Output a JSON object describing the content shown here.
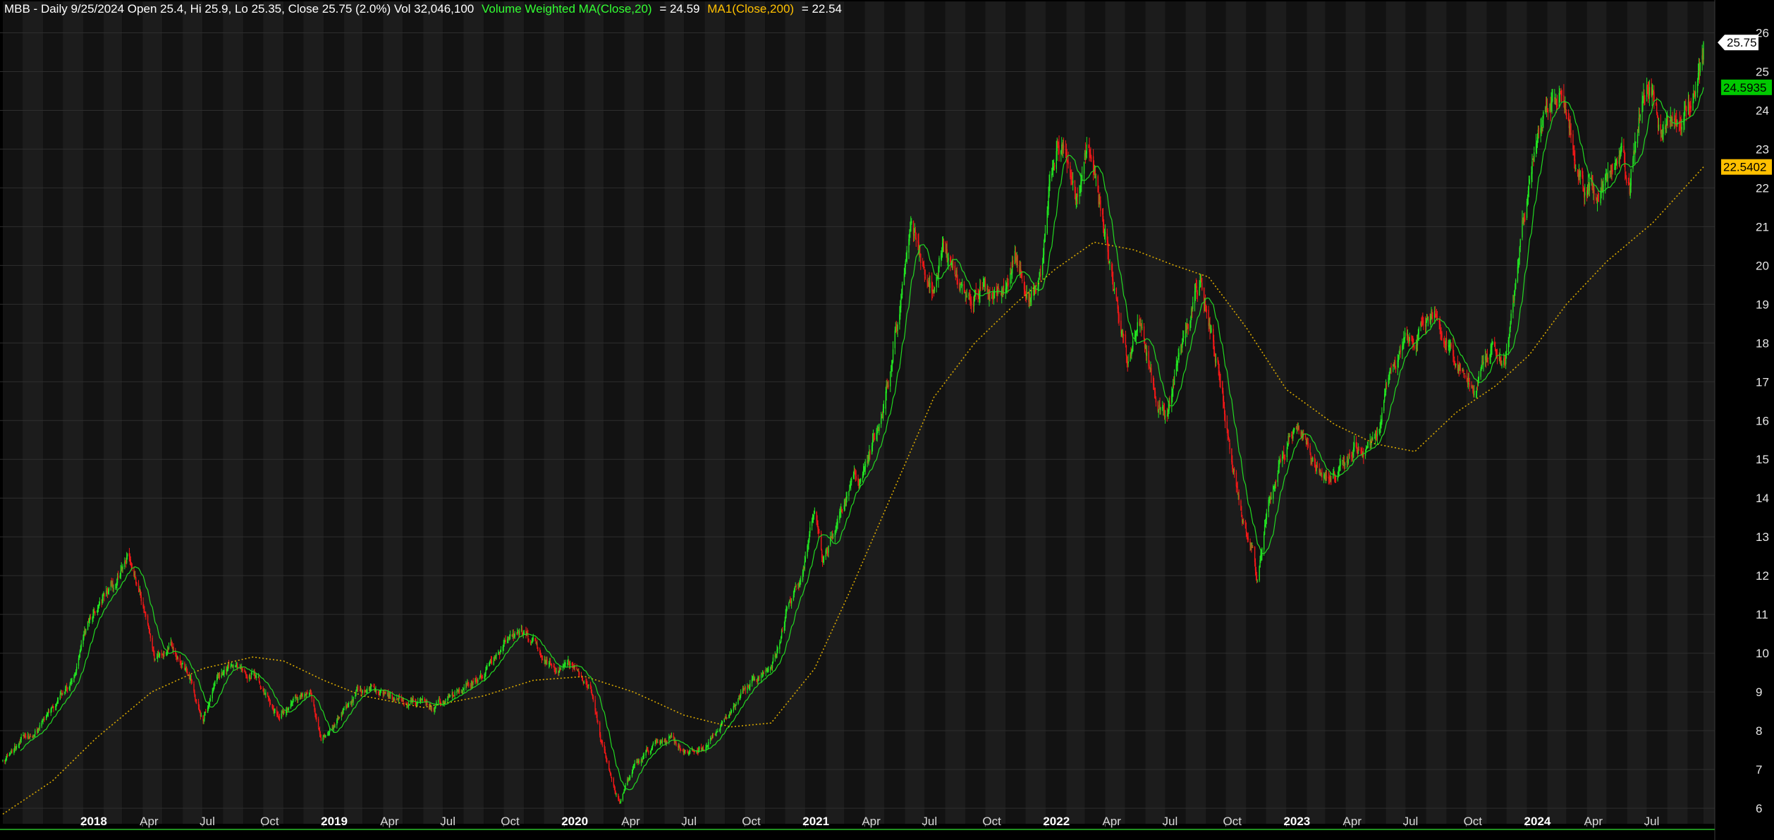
{
  "header": {
    "symbol_line": "MBB - Daily 9/25/2024 Open 25.4, Hi 25.9, Lo 25.35, Close 25.75 (2.0%) Vol 32,046,100",
    "vwma_label": "Volume Weighted MA(Close,20)",
    "vwma_value": "= 24.59",
    "ma_label": "MA1(Close,200)",
    "ma_value": "= 22.54"
  },
  "colors": {
    "background": "#000000",
    "band_light": "#1c1c1c",
    "band_dark": "#121212",
    "grid": "#2e2e2e",
    "up": "#22e322",
    "down": "#f01818",
    "vwma": "#22d822",
    "ma200": "#d9a800",
    "header_text": "#ffffff",
    "vwma_text": "#33ff33",
    "ma_text": "#ffc000",
    "price_tag_bg": "#ffffff",
    "vwma_tag_bg": "#00c800",
    "ma_tag_bg": "#ffc000"
  },
  "tags": {
    "close": "25.75",
    "vwma": "24.5935",
    "ma200": "22.5402"
  },
  "chart_data": {
    "type": "candlestick",
    "ylim": [
      5.6,
      26.3
    ],
    "y_ticks": [
      6,
      7,
      8,
      9,
      10,
      11,
      12,
      13,
      14,
      15,
      16,
      17,
      18,
      19,
      20,
      21,
      22,
      23,
      24,
      25,
      26
    ],
    "x_start": "2017-09-01",
    "x_end": "2024-09-25",
    "x_ticks": [
      {
        "label": "2018",
        "date": "2018-01-01",
        "year": true
      },
      {
        "label": "Apr",
        "date": "2018-04-01"
      },
      {
        "label": "Jul",
        "date": "2018-07-01"
      },
      {
        "label": "Oct",
        "date": "2018-10-01"
      },
      {
        "label": "2019",
        "date": "2019-01-01",
        "year": true
      },
      {
        "label": "Apr",
        "date": "2019-04-01"
      },
      {
        "label": "Jul",
        "date": "2019-07-01"
      },
      {
        "label": "Oct",
        "date": "2019-10-01"
      },
      {
        "label": "2020",
        "date": "2020-01-01",
        "year": true
      },
      {
        "label": "Apr",
        "date": "2020-04-01"
      },
      {
        "label": "Jul",
        "date": "2020-07-01"
      },
      {
        "label": "Oct",
        "date": "2020-10-01"
      },
      {
        "label": "2021",
        "date": "2021-01-01",
        "year": true
      },
      {
        "label": "Apr",
        "date": "2021-04-01"
      },
      {
        "label": "Jul",
        "date": "2021-07-01"
      },
      {
        "label": "Oct",
        "date": "2021-10-01"
      },
      {
        "label": "2022",
        "date": "2022-01-01",
        "year": true
      },
      {
        "label": "Apr",
        "date": "2022-04-01"
      },
      {
        "label": "Jul",
        "date": "2022-07-01"
      },
      {
        "label": "Oct",
        "date": "2022-10-01"
      },
      {
        "label": "2023",
        "date": "2023-01-01",
        "year": true
      },
      {
        "label": "Apr",
        "date": "2023-04-01"
      },
      {
        "label": "Jul",
        "date": "2023-07-01"
      },
      {
        "label": "Oct",
        "date": "2023-10-01"
      },
      {
        "label": "2024",
        "date": "2024-01-01",
        "year": true
      },
      {
        "label": "Apr",
        "date": "2024-04-01"
      },
      {
        "label": "Jul",
        "date": "2024-07-01"
      }
    ],
    "price_path": [
      [
        "2017-09-01",
        7.3
      ],
      [
        "2017-10-15",
        7.9
      ],
      [
        "2017-11-20",
        8.6
      ],
      [
        "2017-12-20",
        9.4
      ],
      [
        "2018-01-10",
        10.8
      ],
      [
        "2018-02-05",
        11.5
      ],
      [
        "2018-02-20",
        11.8
      ],
      [
        "2018-03-10",
        12.4
      ],
      [
        "2018-04-01",
        11.3
      ],
      [
        "2018-04-20",
        10.0
      ],
      [
        "2018-05-15",
        10.4
      ],
      [
        "2018-06-10",
        9.5
      ],
      [
        "2018-07-01",
        8.2
      ],
      [
        "2018-07-25",
        9.3
      ],
      [
        "2018-08-15",
        9.7
      ],
      [
        "2018-09-15",
        9.5
      ],
      [
        "2018-10-05",
        9.0
      ],
      [
        "2018-10-25",
        8.4
      ],
      [
        "2018-11-20",
        8.8
      ],
      [
        "2018-12-10",
        9.0
      ],
      [
        "2018-12-28",
        7.6
      ],
      [
        "2019-01-25",
        8.4
      ],
      [
        "2019-02-20",
        9.0
      ],
      [
        "2019-03-20",
        9.1
      ],
      [
        "2019-04-20",
        8.8
      ],
      [
        "2019-05-20",
        8.7
      ],
      [
        "2019-06-15",
        8.6
      ],
      [
        "2019-07-15",
        8.9
      ],
      [
        "2019-08-20",
        9.3
      ],
      [
        "2019-09-15",
        9.7
      ],
      [
        "2019-10-15",
        10.3
      ],
      [
        "2019-10-30",
        10.5
      ],
      [
        "2019-11-25",
        9.9
      ],
      [
        "2019-12-20",
        9.5
      ],
      [
        "2020-01-10",
        9.7
      ],
      [
        "2020-01-25",
        9.3
      ],
      [
        "2020-02-10",
        9.2
      ],
      [
        "2020-02-25",
        7.8
      ],
      [
        "2020-03-10",
        7.0
      ],
      [
        "2020-03-25",
        6.1
      ],
      [
        "2020-04-15",
        7.0
      ],
      [
        "2020-05-15",
        7.6
      ],
      [
        "2020-06-10",
        7.9
      ],
      [
        "2020-07-10",
        7.4
      ],
      [
        "2020-08-01",
        7.6
      ],
      [
        "2020-08-25",
        8.1
      ],
      [
        "2020-09-20",
        8.6
      ],
      [
        "2020-10-20",
        9.3
      ],
      [
        "2020-11-20",
        10.2
      ],
      [
        "2020-12-15",
        11.8
      ],
      [
        "2020-12-30",
        12.2
      ],
      [
        "2021-01-15",
        13.6
      ],
      [
        "2021-01-28",
        12.3
      ],
      [
        "2021-02-10",
        13.0
      ],
      [
        "2021-03-05",
        14.1
      ],
      [
        "2021-03-25",
        14.5
      ],
      [
        "2021-04-15",
        15.5
      ],
      [
        "2021-05-05",
        17.0
      ],
      [
        "2021-05-25",
        19.2
      ],
      [
        "2021-06-10",
        21.5
      ],
      [
        "2021-06-28",
        20.2
      ],
      [
        "2021-07-12",
        19.3
      ],
      [
        "2021-07-28",
        20.8
      ],
      [
        "2021-08-15",
        19.8
      ],
      [
        "2021-09-05",
        19.4
      ],
      [
        "2021-10-05",
        19.3
      ],
      [
        "2021-10-25",
        19.6
      ],
      [
        "2021-11-15",
        20.6
      ],
      [
        "2021-12-05",
        19.1
      ],
      [
        "2021-12-25",
        19.9
      ],
      [
        "2022-01-05",
        21.8
      ],
      [
        "2022-01-18",
        23.3
      ],
      [
        "2022-02-05",
        22.4
      ],
      [
        "2022-02-20",
        21.8
      ],
      [
        "2022-03-05",
        22.9
      ],
      [
        "2022-03-20",
        21.8
      ],
      [
        "2022-04-05",
        20.3
      ],
      [
        "2022-04-20",
        18.8
      ],
      [
        "2022-05-05",
        17.4
      ],
      [
        "2022-05-20",
        18.7
      ],
      [
        "2022-06-05",
        17.6
      ],
      [
        "2022-06-20",
        16.4
      ],
      [
        "2022-07-05",
        16.2
      ],
      [
        "2022-07-20",
        17.5
      ],
      [
        "2022-08-10",
        18.7
      ],
      [
        "2022-08-25",
        19.6
      ],
      [
        "2022-09-10",
        18.1
      ],
      [
        "2022-09-25",
        17.0
      ],
      [
        "2022-10-10",
        15.2
      ],
      [
        "2022-10-25",
        13.7
      ],
      [
        "2022-11-10",
        12.8
      ],
      [
        "2022-11-18",
        11.9
      ],
      [
        "2022-12-01",
        13.4
      ],
      [
        "2022-12-20",
        14.9
      ],
      [
        "2023-01-10",
        15.8
      ],
      [
        "2023-01-30",
        15.4
      ],
      [
        "2023-02-20",
        14.6
      ],
      [
        "2023-03-10",
        14.4
      ],
      [
        "2023-04-10",
        15.1
      ],
      [
        "2023-05-10",
        15.4
      ],
      [
        "2023-05-25",
        16.0
      ],
      [
        "2023-06-10",
        17.3
      ],
      [
        "2023-07-05",
        18.0
      ],
      [
        "2023-07-25",
        18.5
      ],
      [
        "2023-08-15",
        18.6
      ],
      [
        "2023-09-05",
        18.0
      ],
      [
        "2023-09-25",
        17.3
      ],
      [
        "2023-10-15",
        16.8
      ],
      [
        "2023-11-05",
        17.5
      ],
      [
        "2023-11-25",
        17.3
      ],
      [
        "2023-12-10",
        18.8
      ],
      [
        "2023-12-28",
        21.3
      ],
      [
        "2024-01-15",
        23.1
      ],
      [
        "2024-02-05",
        24.0
      ],
      [
        "2024-02-20",
        24.6
      ],
      [
        "2024-03-10",
        23.3
      ],
      [
        "2024-03-28",
        22.1
      ],
      [
        "2024-04-20",
        22.0
      ],
      [
        "2024-05-10",
        22.7
      ],
      [
        "2024-05-25",
        23.4
      ],
      [
        "2024-06-05",
        22.4
      ],
      [
        "2024-06-20",
        24.2
      ],
      [
        "2024-07-05",
        24.8
      ],
      [
        "2024-07-20",
        23.6
      ],
      [
        "2024-08-05",
        24.0
      ],
      [
        "2024-08-25",
        24.2
      ],
      [
        "2024-09-10",
        24.6
      ],
      [
        "2024-09-25",
        25.75
      ]
    ],
    "vwma20_end": 24.59,
    "ma200_path": [
      [
        "2017-09-01",
        5.85
      ],
      [
        "2017-11-15",
        6.7
      ],
      [
        "2018-01-20",
        7.8
      ],
      [
        "2018-04-15",
        9.0
      ],
      [
        "2018-07-01",
        9.6
      ],
      [
        "2018-09-15",
        9.9
      ],
      [
        "2018-11-01",
        9.8
      ],
      [
        "2019-01-01",
        9.3
      ],
      [
        "2019-03-01",
        8.9
      ],
      [
        "2019-06-01",
        8.6
      ],
      [
        "2019-09-01",
        8.9
      ],
      [
        "2019-11-15",
        9.3
      ],
      [
        "2020-02-01",
        9.4
      ],
      [
        "2020-04-15",
        9.0
      ],
      [
        "2020-07-01",
        8.4
      ],
      [
        "2020-09-10",
        8.1
      ],
      [
        "2020-11-10",
        8.2
      ],
      [
        "2021-01-15",
        9.6
      ],
      [
        "2021-03-15",
        11.8
      ],
      [
        "2021-05-15",
        14.2
      ],
      [
        "2021-07-15",
        16.6
      ],
      [
        "2021-09-15",
        18.0
      ],
      [
        "2021-11-15",
        19.0
      ],
      [
        "2022-01-15",
        19.9
      ],
      [
        "2022-03-15",
        20.6
      ],
      [
        "2022-05-15",
        20.4
      ],
      [
        "2022-07-15",
        20.0
      ],
      [
        "2022-09-05",
        19.7
      ],
      [
        "2022-11-01",
        18.4
      ],
      [
        "2023-01-01",
        16.8
      ],
      [
        "2023-03-15",
        15.9
      ],
      [
        "2023-05-15",
        15.4
      ],
      [
        "2023-07-15",
        15.2
      ],
      [
        "2023-09-15",
        16.2
      ],
      [
        "2023-11-15",
        16.9
      ],
      [
        "2024-01-05",
        17.7
      ],
      [
        "2024-03-01",
        19.0
      ],
      [
        "2024-05-01",
        20.1
      ],
      [
        "2024-07-10",
        21.1
      ],
      [
        "2024-09-25",
        22.54
      ]
    ],
    "last_close": 25.75,
    "last_vwma": 24.5935,
    "last_ma200": 22.5402
  }
}
